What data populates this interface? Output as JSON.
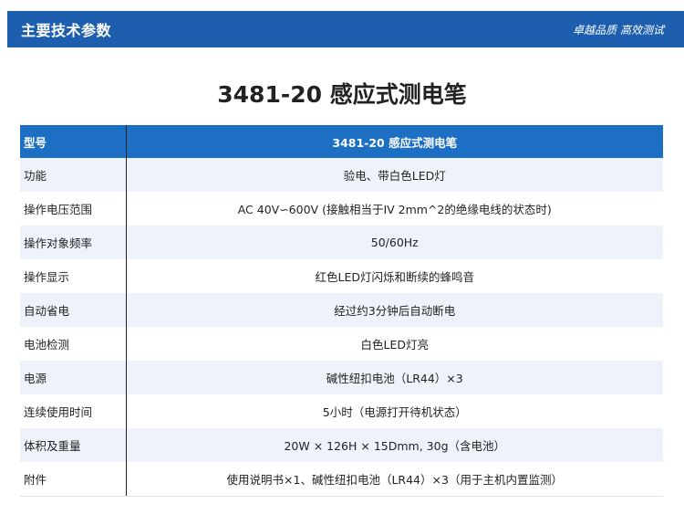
{
  "header": {
    "title": "主要技术参数",
    "slogan": "卓越品质 高效测试"
  },
  "page_title": "3481-20 感应式测电笔",
  "table": {
    "header": {
      "label": "型号",
      "value": "3481-20 感应式测电笔"
    },
    "rows": [
      {
        "label": "功能",
        "value": "验电、带白色LED灯"
      },
      {
        "label": "操作电压范围",
        "value": "AC 40V∽600V (接触相当于IV 2mm^2的绝缘电线的状态时)"
      },
      {
        "label": "操作对象频率",
        "value": "50/60Hz"
      },
      {
        "label": "操作显示",
        "value": "红色LED灯闪烁和断续的蜂鸣音"
      },
      {
        "label": "自动省电",
        "value": "经过约3分钟后自动断电"
      },
      {
        "label": "电池检测",
        "value": "白色LED灯亮"
      },
      {
        "label": "电源",
        "value": "碱性纽扣电池（LR44）×3"
      },
      {
        "label": "连续使用时间",
        "value": "5小时（电源打开待机状态）"
      },
      {
        "label": "体积及重量",
        "value": "20W × 126H × 15Dmm, 30g（含电池）"
      },
      {
        "label": "附件",
        "value": "使用说明书×1、碱性纽扣电池（LR44）×3（用于主机内置监测）"
      }
    ]
  }
}
